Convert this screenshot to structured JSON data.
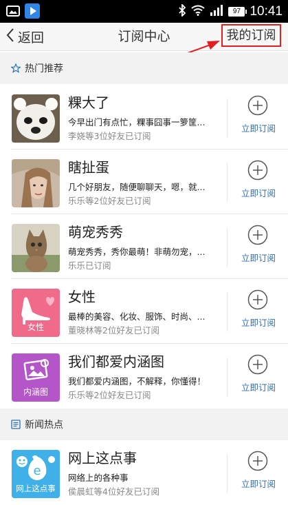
{
  "status_bar": {
    "time": "10:41",
    "battery": "97"
  },
  "header": {
    "back_label": "返回",
    "title": "订阅中心",
    "my_subscriptions": "我的订阅"
  },
  "sections": [
    {
      "label": "热门推荐",
      "icon": "star-outline-icon"
    },
    {
      "label": "新闻热点",
      "icon": "newspaper-icon"
    }
  ],
  "subscribe_label": "立即订阅",
  "items": [
    {
      "title": "粿大了",
      "desc": "今早出门有点忙，粿事囧事一箩筐...",
      "meta": "李娆等3位好友已订阅"
    },
    {
      "title": "瞎扯蛋",
      "desc": "几个好朋友，随便聊聊天，嗯，就...",
      "meta": "乐乐等2位好友已订阅"
    },
    {
      "title": "萌宠秀秀",
      "desc": "萌宠秀秀，秀你最萌！非萌勿宠，...",
      "meta": "乐乐已订阅"
    },
    {
      "title": "女性",
      "desc": "最棒的美容、化妆、服饰、时尚、...",
      "meta": "董晓林等2位好友已订阅",
      "thumb_text": "女性"
    },
    {
      "title": "我们都爱内涵图",
      "desc": "我们都爱内涵图，不解释，你懂得！",
      "meta": "乐乐等2位好友已订阅",
      "thumb_text": "内涵图"
    },
    {
      "title": "网上这点事",
      "desc": "网络上的各种事",
      "meta": "侯晨虹等4位好友已订阅",
      "thumb_text": "网上这点事"
    }
  ],
  "colors": {
    "accent_blue": "#2a6fb8",
    "highlight_red": "#e02020",
    "female_pink": "#f06a8a",
    "neihan_purple": "#b455c9",
    "web_blue": "#3fb0e8"
  }
}
